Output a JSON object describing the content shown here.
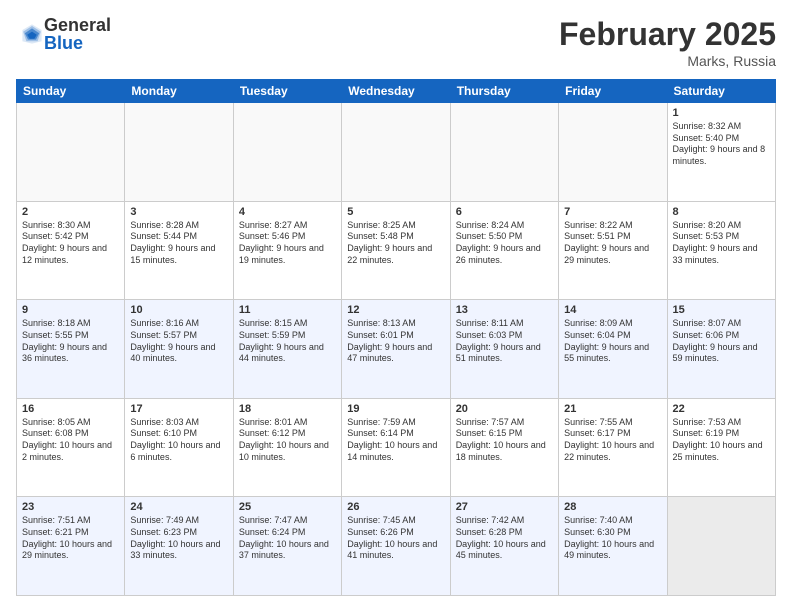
{
  "logo": {
    "general": "General",
    "blue": "Blue"
  },
  "header": {
    "month": "February 2025",
    "location": "Marks, Russia"
  },
  "days_of_week": [
    "Sunday",
    "Monday",
    "Tuesday",
    "Wednesday",
    "Thursday",
    "Friday",
    "Saturday"
  ],
  "weeks": [
    {
      "shade": false,
      "days": [
        {
          "num": "",
          "info": ""
        },
        {
          "num": "",
          "info": ""
        },
        {
          "num": "",
          "info": ""
        },
        {
          "num": "",
          "info": ""
        },
        {
          "num": "",
          "info": ""
        },
        {
          "num": "",
          "info": ""
        },
        {
          "num": "1",
          "info": "Sunrise: 8:32 AM\nSunset: 5:40 PM\nDaylight: 9 hours and 8 minutes."
        }
      ]
    },
    {
      "shade": false,
      "days": [
        {
          "num": "2",
          "info": "Sunrise: 8:30 AM\nSunset: 5:42 PM\nDaylight: 9 hours and 12 minutes."
        },
        {
          "num": "3",
          "info": "Sunrise: 8:28 AM\nSunset: 5:44 PM\nDaylight: 9 hours and 15 minutes."
        },
        {
          "num": "4",
          "info": "Sunrise: 8:27 AM\nSunset: 5:46 PM\nDaylight: 9 hours and 19 minutes."
        },
        {
          "num": "5",
          "info": "Sunrise: 8:25 AM\nSunset: 5:48 PM\nDaylight: 9 hours and 22 minutes."
        },
        {
          "num": "6",
          "info": "Sunrise: 8:24 AM\nSunset: 5:50 PM\nDaylight: 9 hours and 26 minutes."
        },
        {
          "num": "7",
          "info": "Sunrise: 8:22 AM\nSunset: 5:51 PM\nDaylight: 9 hours and 29 minutes."
        },
        {
          "num": "8",
          "info": "Sunrise: 8:20 AM\nSunset: 5:53 PM\nDaylight: 9 hours and 33 minutes."
        }
      ]
    },
    {
      "shade": true,
      "days": [
        {
          "num": "9",
          "info": "Sunrise: 8:18 AM\nSunset: 5:55 PM\nDaylight: 9 hours and 36 minutes."
        },
        {
          "num": "10",
          "info": "Sunrise: 8:16 AM\nSunset: 5:57 PM\nDaylight: 9 hours and 40 minutes."
        },
        {
          "num": "11",
          "info": "Sunrise: 8:15 AM\nSunset: 5:59 PM\nDaylight: 9 hours and 44 minutes."
        },
        {
          "num": "12",
          "info": "Sunrise: 8:13 AM\nSunset: 6:01 PM\nDaylight: 9 hours and 47 minutes."
        },
        {
          "num": "13",
          "info": "Sunrise: 8:11 AM\nSunset: 6:03 PM\nDaylight: 9 hours and 51 minutes."
        },
        {
          "num": "14",
          "info": "Sunrise: 8:09 AM\nSunset: 6:04 PM\nDaylight: 9 hours and 55 minutes."
        },
        {
          "num": "15",
          "info": "Sunrise: 8:07 AM\nSunset: 6:06 PM\nDaylight: 9 hours and 59 minutes."
        }
      ]
    },
    {
      "shade": false,
      "days": [
        {
          "num": "16",
          "info": "Sunrise: 8:05 AM\nSunset: 6:08 PM\nDaylight: 10 hours and 2 minutes."
        },
        {
          "num": "17",
          "info": "Sunrise: 8:03 AM\nSunset: 6:10 PM\nDaylight: 10 hours and 6 minutes."
        },
        {
          "num": "18",
          "info": "Sunrise: 8:01 AM\nSunset: 6:12 PM\nDaylight: 10 hours and 10 minutes."
        },
        {
          "num": "19",
          "info": "Sunrise: 7:59 AM\nSunset: 6:14 PM\nDaylight: 10 hours and 14 minutes."
        },
        {
          "num": "20",
          "info": "Sunrise: 7:57 AM\nSunset: 6:15 PM\nDaylight: 10 hours and 18 minutes."
        },
        {
          "num": "21",
          "info": "Sunrise: 7:55 AM\nSunset: 6:17 PM\nDaylight: 10 hours and 22 minutes."
        },
        {
          "num": "22",
          "info": "Sunrise: 7:53 AM\nSunset: 6:19 PM\nDaylight: 10 hours and 25 minutes."
        }
      ]
    },
    {
      "shade": true,
      "days": [
        {
          "num": "23",
          "info": "Sunrise: 7:51 AM\nSunset: 6:21 PM\nDaylight: 10 hours and 29 minutes."
        },
        {
          "num": "24",
          "info": "Sunrise: 7:49 AM\nSunset: 6:23 PM\nDaylight: 10 hours and 33 minutes."
        },
        {
          "num": "25",
          "info": "Sunrise: 7:47 AM\nSunset: 6:24 PM\nDaylight: 10 hours and 37 minutes."
        },
        {
          "num": "26",
          "info": "Sunrise: 7:45 AM\nSunset: 6:26 PM\nDaylight: 10 hours and 41 minutes."
        },
        {
          "num": "27",
          "info": "Sunrise: 7:42 AM\nSunset: 6:28 PM\nDaylight: 10 hours and 45 minutes."
        },
        {
          "num": "28",
          "info": "Sunrise: 7:40 AM\nSunset: 6:30 PM\nDaylight: 10 hours and 49 minutes."
        },
        {
          "num": "",
          "info": ""
        }
      ]
    }
  ]
}
